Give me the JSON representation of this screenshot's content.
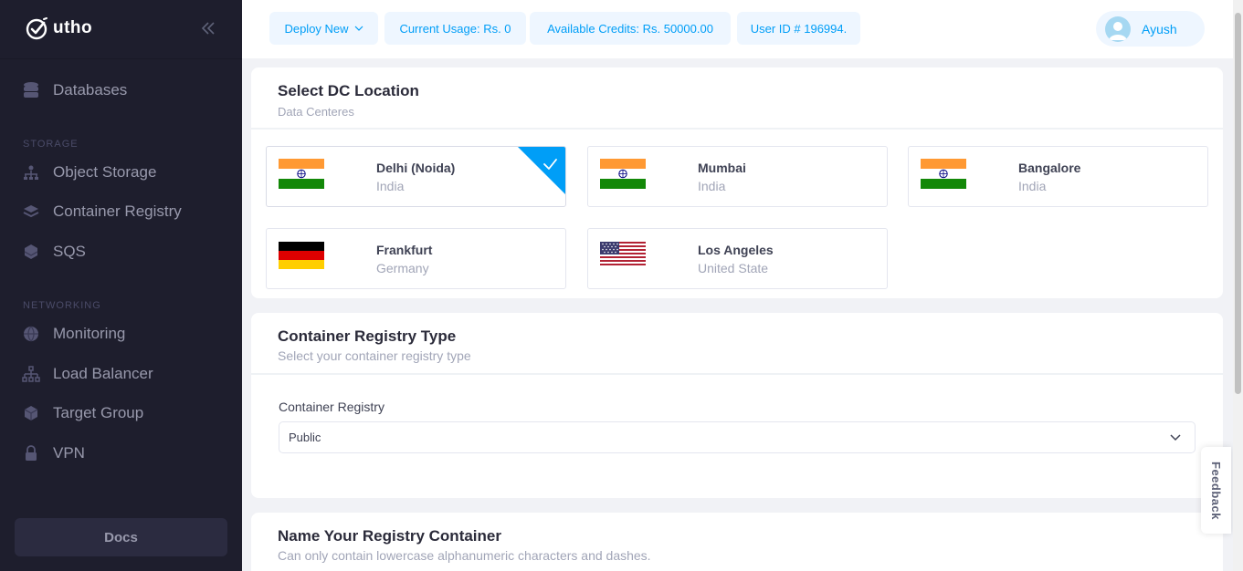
{
  "brand": {
    "name": "utho"
  },
  "sidebar": {
    "items": [
      {
        "label": "Databases",
        "icon": "database-icon"
      },
      {
        "label": "Object Storage",
        "icon": "object-storage-icon"
      },
      {
        "label": "Container Registry",
        "icon": "layers-icon"
      },
      {
        "label": "SQS",
        "icon": "queue-icon"
      },
      {
        "label": "Monitoring",
        "icon": "globe-icon"
      },
      {
        "label": "Load Balancer",
        "icon": "network-icon"
      },
      {
        "label": "Target Group",
        "icon": "cube-icon"
      },
      {
        "label": "VPN",
        "icon": "lock-icon"
      }
    ],
    "sections": {
      "storage": "STORAGE",
      "networking": "NETWORKING"
    },
    "docs_label": "Docs"
  },
  "header": {
    "deploy_label": "Deploy New",
    "usage": "Current Usage: Rs. 0",
    "credits": "Available Credits: Rs. 50000.00",
    "user_id": "User ID # 196994.",
    "user_name": "Ayush"
  },
  "dc_section": {
    "title": "Select DC Location",
    "subtitle": "Data Centeres",
    "locations": [
      {
        "city": "Delhi (Noida)",
        "country": "India",
        "flag": "india",
        "selected": true
      },
      {
        "city": "Mumbai",
        "country": "India",
        "flag": "india",
        "selected": false
      },
      {
        "city": "Bangalore",
        "country": "India",
        "flag": "india",
        "selected": false
      },
      {
        "city": "Frankfurt",
        "country": "Germany",
        "flag": "germany",
        "selected": false
      },
      {
        "city": "Los Angeles",
        "country": "United State",
        "flag": "usa",
        "selected": false
      }
    ]
  },
  "registry_type": {
    "title": "Container Registry Type",
    "subtitle": "Select your container registry type",
    "field_label": "Container Registry",
    "selected_value": "Public"
  },
  "name_section": {
    "title": "Name Your Registry Container",
    "subtitle": "Can only contain lowercase alphanumeric characters and dashes."
  },
  "feedback_label": "Feedback",
  "colors": {
    "sidebar_bg": "#1e1e2d",
    "accent": "#009ef7",
    "page_bg": "#f1f2f6"
  }
}
